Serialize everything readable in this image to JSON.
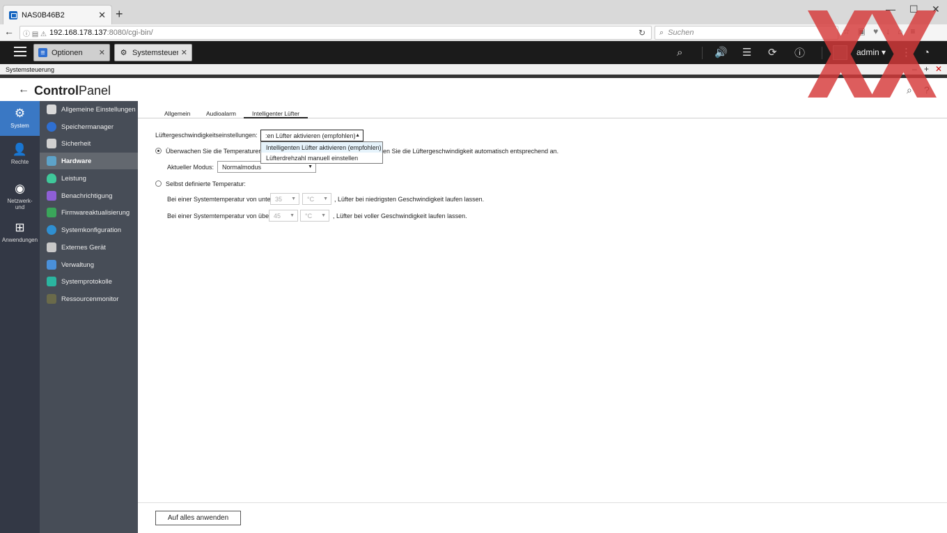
{
  "browser": {
    "tab_title": "NAS0B46B2",
    "url_host": "192.168.178.137",
    "url_path": ":8080/cgi-bin/",
    "search_placeholder": "Suchen"
  },
  "qnap_bar": {
    "tabs": [
      {
        "label": "Optionen"
      },
      {
        "label": "Systemsteueru..."
      }
    ],
    "user": "admin"
  },
  "window": {
    "title": "Systemsteuerung"
  },
  "header": {
    "title_bold": "Control",
    "title_rest": "Panel"
  },
  "rail": {
    "items": [
      {
        "label": "System"
      },
      {
        "label": "Rechte"
      },
      {
        "label": "Netzwerk-",
        "label2": "und"
      },
      {
        "label": "Anwendungen"
      }
    ]
  },
  "submenu": {
    "items": [
      {
        "label": "Allgemeine Einstellungen",
        "color": "#d9d9d9"
      },
      {
        "label": "Speichermanager",
        "color": "#2f6fd1"
      },
      {
        "label": "Sicherheit",
        "color": "#d0d0d0"
      },
      {
        "label": "Hardware",
        "color": "#5da3c9"
      },
      {
        "label": "Leistung",
        "color": "#3fc89a"
      },
      {
        "label": "Benachrichtigung",
        "color": "#8e5fd6"
      },
      {
        "label": "Firmwareaktualisierung",
        "color": "#3aa55a"
      },
      {
        "label": "Systemkonfiguration",
        "color": "#2f8fd1"
      },
      {
        "label": "Externes Gerät",
        "color": "#c8c8c8"
      },
      {
        "label": "Verwaltung",
        "color": "#4a90d9"
      },
      {
        "label": "Systemprotokolle",
        "color": "#2bb5a0"
      },
      {
        "label": "Ressourcenmonitor",
        "color": "#6a6a4a"
      }
    ]
  },
  "content": {
    "tabs": [
      {
        "label": "Allgemein"
      },
      {
        "label": "Audioalarm"
      },
      {
        "label": "Intelligenter Lüfter"
      }
    ],
    "fan_setting_label": "Lüftergeschwindigkeitseinstellungen:",
    "fan_setting_value": ":en Lüfter aktivieren (empfohlen)",
    "dropdown_options": [
      {
        "label": "Intelligenten Lüfter aktivieren (empfohlen)"
      },
      {
        "label": "Lüfterdrehzahl manuell einstellen"
      }
    ],
    "monitor_text_a": "Überwachen Sie die Temperaturen w",
    "monitor_text_b": "en Sie die Lüftergeschwindigkeit automatisch entsprechend an.",
    "mode_label": "Aktueller Modus:",
    "mode_value": "Normalmodus",
    "custom_label": "Selbst definierte Temperatur:",
    "low_prefix": "Bei einer Systemtemperatur von unter",
    "low_value": "35",
    "low_unit": "°C",
    "low_suffix": ", Lüfter bei niedrigsten Geschwindigkeit laufen lassen.",
    "high_prefix": "Bei einer Systemtemperatur von über",
    "high_value": "45",
    "high_unit": "°C",
    "high_suffix": ", Lüfter bei voller Geschwindigkeit laufen lassen.",
    "apply_label": "Auf alles anwenden"
  }
}
